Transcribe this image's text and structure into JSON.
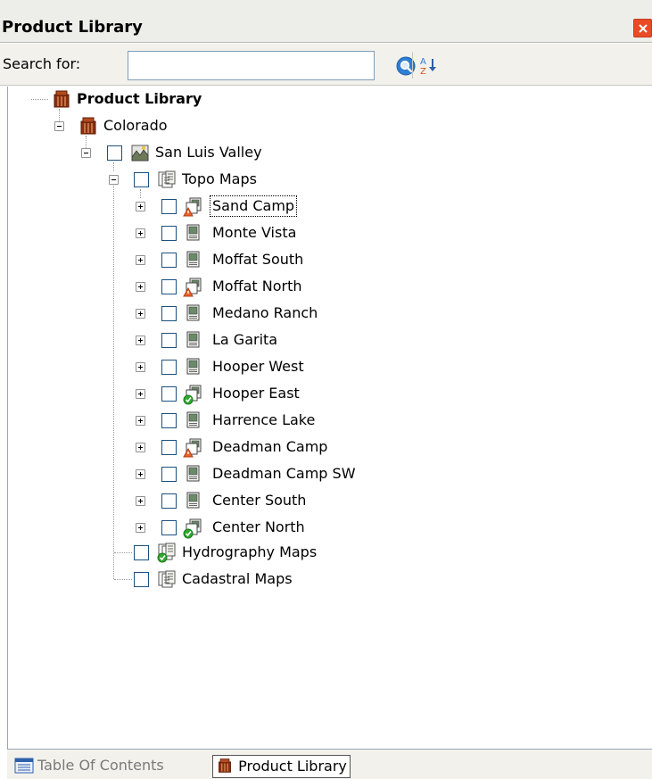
{
  "window": {
    "title": "Product Library"
  },
  "toolbar": {
    "search_label": "Search for:",
    "search_value": "",
    "search_placeholder": ""
  },
  "tree": {
    "root_label": "Product Library",
    "state_label": "Colorado",
    "region_label": "San Luis Valley",
    "topo_label": "Topo Maps",
    "topo_items": [
      {
        "label": "Sand Camp",
        "status": "warning",
        "selected": true
      },
      {
        "label": "Monte Vista",
        "status": "none"
      },
      {
        "label": "Moffat South",
        "status": "none"
      },
      {
        "label": "Moffat North",
        "status": "warning"
      },
      {
        "label": "Medano Ranch",
        "status": "none"
      },
      {
        "label": "La Garita",
        "status": "none"
      },
      {
        "label": "Hooper West",
        "status": "none"
      },
      {
        "label": "Hooper East",
        "status": "ok"
      },
      {
        "label": "Harrence Lake",
        "status": "none"
      },
      {
        "label": "Deadman Camp",
        "status": "warning"
      },
      {
        "label": "Deadman Camp SW",
        "status": "none"
      },
      {
        "label": "Center South",
        "status": "none"
      },
      {
        "label": "Center North",
        "status": "ok"
      }
    ],
    "hydro_label": "Hydrography Maps",
    "cadastral_label": "Cadastral Maps"
  },
  "tabs": [
    {
      "label": "Table Of Contents",
      "active": false
    },
    {
      "label": "Product Library",
      "active": true
    }
  ],
  "icons": {
    "close": "close-icon",
    "search": "magnifier-icon",
    "sort": "sort-az-icon",
    "library": "library-icon",
    "region": "region-map-icon",
    "map_sheet": "map-sheet-icon",
    "map_collection": "map-collection-icon"
  },
  "colors": {
    "close": "#ea4a26",
    "warning": "#e8622a",
    "ok": "#2ea82e",
    "search": "#2f7fd1",
    "library": "#8a2e0e"
  }
}
